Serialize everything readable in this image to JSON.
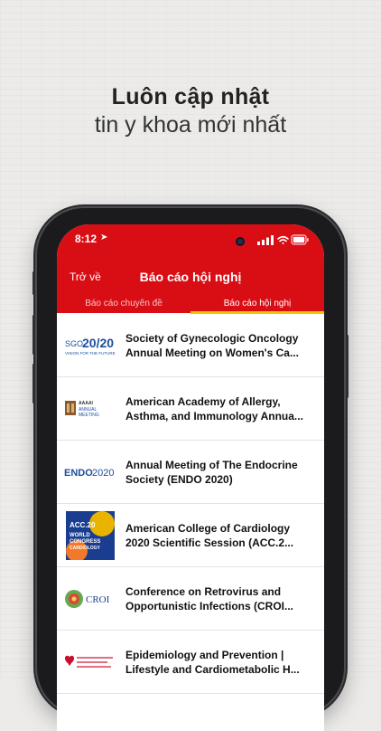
{
  "headline": {
    "line1": "Luôn cập nhật",
    "line2": "tin y khoa mới nhất"
  },
  "status_bar": {
    "time": "8:12"
  },
  "navbar": {
    "back_label": "Trở về",
    "title": "Báo cáo hội nghị"
  },
  "tabs": [
    {
      "label": "Báo cáo chuyên đề",
      "selected": false
    },
    {
      "label": "Báo cáo hội nghị",
      "selected": true
    }
  ],
  "conferences": [
    {
      "logo": "SGO 20/20",
      "logo_sub": "VISION FOR THE FUTURE",
      "line1": "Society of Gynecologic Oncology",
      "line2": "Annual Meeting on Women's Ca..."
    },
    {
      "logo": "AAAAI",
      "logo_sub": "ANNUAL MEETING",
      "line1": "American Academy of Allergy,",
      "line2": "Asthma, and Immunology Annua..."
    },
    {
      "logo": "ENDO2020",
      "logo_sub": "",
      "line1": "Annual Meeting of The Endocrine",
      "line2": "Society (ENDO 2020)"
    },
    {
      "logo": "ACC.20 WORLD CONGRESS OF CARDIOLOGY",
      "logo_sub": "",
      "line1": "American College of Cardiology",
      "line2": "2020 Scientific Session (ACC.2..."
    },
    {
      "logo": "CROI",
      "logo_sub": "",
      "line1": "Conference on Retrovirus and",
      "line2": "Opportunistic Infections (CROI..."
    },
    {
      "logo": "AHA",
      "logo_sub": "",
      "line1": "Epidemiology and Prevention |",
      "line2": "Lifestyle and Cardiometabolic H..."
    }
  ],
  "colors": {
    "header_red": "#d90e15",
    "tab_indicator": "#f5c400",
    "sgo_blue": "#1c4f9c",
    "endo_blue": "#1c4f9c"
  }
}
